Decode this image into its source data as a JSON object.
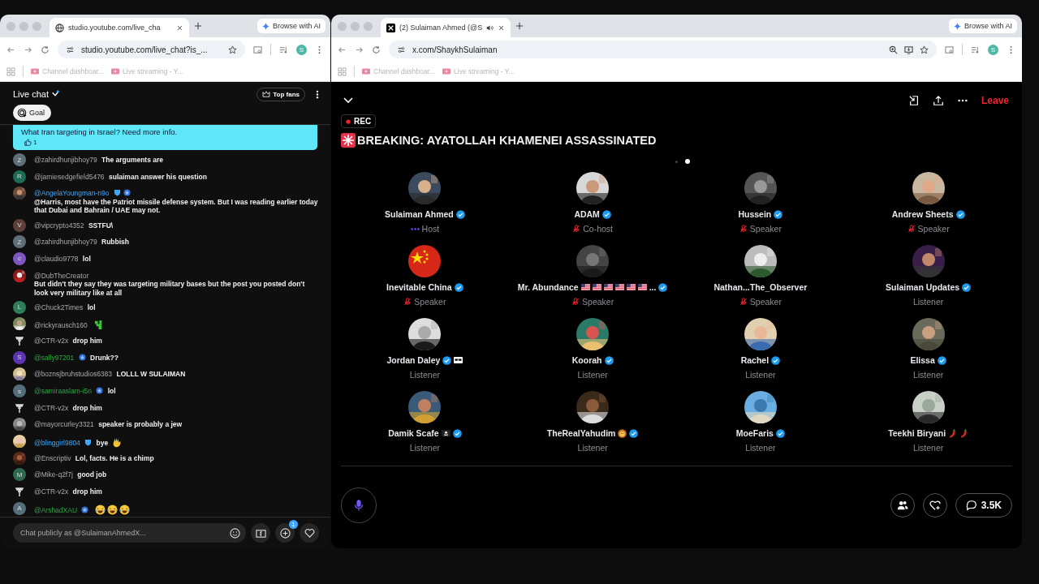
{
  "left_window": {
    "tab": {
      "title": "studio.youtube.com/live_cha"
    },
    "browse_ai": "Browse with AI",
    "url": "studio.youtube.com/live_chat?is_...",
    "profile": "S",
    "bookmarks": [
      "Channel dashboar...",
      "Live streaming - Y..."
    ],
    "chat": {
      "title": "Live chat",
      "top_fans": "Top fans",
      "goal": "Goal",
      "pinned": {
        "text": "What Iran targeting in Israel? Need more info.",
        "likes": "1"
      },
      "messages": [
        {
          "user": "@zahirdhunjibhoy79",
          "kind": "viewer",
          "avatar": {
            "kind": "letter",
            "letter": "Z",
            "color": "#5f6f78"
          },
          "text": "The arguments are"
        },
        {
          "user": "@jamiesedgefield5476",
          "kind": "viewer",
          "avatar": {
            "kind": "letter",
            "letter": "R",
            "color": "#1f6b55"
          },
          "text": "sulaiman answer his question"
        },
        {
          "user": "@AngelaYoungman-n9o",
          "kind": "moderator",
          "avatar": {
            "kind": "picture"
          },
          "badges": [
            {
              "kind": "shield"
            },
            {
              "kind": "star"
            }
          ],
          "text": "@Harris, most have the Patriot missile defense system. But I was reading earlier today that Dubai and Bahrain / UAE may not."
        },
        {
          "user": "@vipcrypto4352",
          "kind": "viewer",
          "avatar": {
            "kind": "letter",
            "letter": "V",
            "color": "#5d4037"
          },
          "text": "SSTFU\\"
        },
        {
          "user": "@zahirdhunjibhoy79",
          "kind": "viewer",
          "avatar": {
            "kind": "letter",
            "letter": "Z",
            "color": "#5f6f78"
          },
          "text": "Rubbish"
        },
        {
          "user": "@claudio9778",
          "kind": "viewer",
          "avatar": {
            "kind": "letter",
            "letter": "c",
            "color": "#7e57c2"
          },
          "text": "lol"
        },
        {
          "user": "@DubTheCreator",
          "kind": "viewer",
          "avatar": {
            "kind": "picture"
          },
          "text": "But didn't they say they was targeting military bases but the post you posted don't look very military like at all"
        },
        {
          "user": "@Chuck2Times",
          "kind": "viewer",
          "avatar": {
            "kind": "letter",
            "letter": "L",
            "color": "#2e7d5b"
          },
          "text": "lol"
        },
        {
          "user": "@rickyrausch160",
          "kind": "viewer",
          "avatar": {
            "kind": "picture"
          },
          "emoji": [
            {
              "kind": "figure"
            }
          ]
        },
        {
          "user": "@CTR-v2x",
          "kind": "viewer",
          "avatar": {
            "kind": "logo"
          },
          "text": "drop him"
        },
        {
          "user": "@sally97201",
          "kind": "member",
          "avatar": {
            "kind": "letter",
            "letter": "S",
            "color": "#5e35b1"
          },
          "badges": [
            {
              "kind": "star"
            }
          ],
          "text": "Drunk??"
        },
        {
          "user": "@boznsjbruhstudios6383",
          "kind": "viewer",
          "avatar": {
            "kind": "picture"
          },
          "text": "LOLLL W SULAIMAN"
        },
        {
          "user": "@samiraaslam-i5n",
          "kind": "member",
          "avatar": {
            "kind": "letter",
            "letter": "s",
            "color": "#546e7a"
          },
          "badges": [
            {
              "kind": "star"
            }
          ],
          "text": "lol"
        },
        {
          "user": "@CTR-v2x",
          "kind": "viewer",
          "avatar": {
            "kind": "logo"
          },
          "text": "drop him"
        },
        {
          "user": "@mayorcurley3321",
          "kind": "viewer",
          "avatar": {
            "kind": "picture"
          },
          "text": "speaker is probably a jew"
        },
        {
          "user": "@blinggirl9804",
          "kind": "moderator",
          "avatar": {
            "kind": "picture"
          },
          "badges": [
            {
              "kind": "shield"
            }
          ],
          "text": "bye",
          "emoji": [
            {
              "kind": "wave"
            }
          ]
        },
        {
          "user": "@Enscriptiv",
          "kind": "viewer",
          "avatar": {
            "kind": "picture"
          },
          "text": "Lol, facts. He is a chimp"
        },
        {
          "user": "@Mike-q2f7j",
          "kind": "viewer",
          "avatar": {
            "kind": "letter",
            "letter": "M",
            "color": "#2e6b4e"
          },
          "text": "good job"
        },
        {
          "user": "@CTR-v2x",
          "kind": "viewer",
          "avatar": {
            "kind": "logo"
          },
          "text": "drop him"
        },
        {
          "user": "@ArshadXAU",
          "kind": "member",
          "avatar": {
            "kind": "letter",
            "letter": "A",
            "color": "#546e7a"
          },
          "badges": [
            {
              "kind": "star"
            }
          ],
          "emoji": [
            {
              "kind": "laugh"
            },
            {
              "kind": "laugh"
            },
            {
              "kind": "laugh"
            }
          ]
        }
      ],
      "input": {
        "placeholder": "Chat publicly as @SulaimanAhmedX..."
      },
      "add_badge": "1"
    }
  },
  "right_window": {
    "tab": {
      "title": "(2) Sulaiman Ahmed (@S"
    },
    "browse_ai": "Browse with AI",
    "url": "x.com/ShaykhSulaiman",
    "profile": "S",
    "bookmarks": [
      "Channel dashboar...",
      "Live streaming - Y..."
    ],
    "space": {
      "leave": "Leave",
      "rec": "REC",
      "title": "BREAKING: AYATOLLAH KHAMENEI ASSASSINATED",
      "pages": [
        {
          "selected": false
        },
        {
          "selected": true
        }
      ],
      "participants": [
        {
          "name": "Sulaiman Ahmed",
          "marks": [
            {
              "kind": "verified"
            }
          ],
          "role": "Host",
          "kind": "host"
        },
        {
          "name": "ADAM",
          "marks": [
            {
              "kind": "verified"
            }
          ],
          "role": "Co-host",
          "kind": "muted"
        },
        {
          "name": "Hussein",
          "marks": [
            {
              "kind": "verified"
            }
          ],
          "role": "Speaker",
          "kind": "muted"
        },
        {
          "name": "Andrew Sheets",
          "marks": [
            {
              "kind": "verified"
            }
          ],
          "role": "Speaker",
          "kind": "muted"
        },
        {
          "name": "Inevitable China",
          "marks": [
            {
              "kind": "verified"
            }
          ],
          "role": "Speaker",
          "kind": "muted"
        },
        {
          "name": "Mr. Abundance",
          "marks": [
            {
              "kind": "flag"
            },
            {
              "kind": "flag"
            },
            {
              "kind": "flag"
            },
            {
              "kind": "flag"
            },
            {
              "kind": "flag"
            },
            {
              "kind": "flag"
            },
            {
              "kind": "text",
              "text": "..."
            },
            {
              "kind": "verified"
            }
          ],
          "role": "Speaker",
          "kind": "muted"
        },
        {
          "name": "Nathan...The_Observer",
          "role": "Speaker",
          "kind": "muted"
        },
        {
          "name": "Sulaiman Updates",
          "marks": [
            {
              "kind": "verified"
            }
          ],
          "role": "Listener",
          "kind": "listener"
        },
        {
          "name": "Jordan Daley",
          "marks": [
            {
              "kind": "verified"
            },
            {
              "kind": "glasses"
            }
          ],
          "role": "Listener",
          "kind": "listener"
        },
        {
          "name": "Koorah",
          "marks": [
            {
              "kind": "verified"
            }
          ],
          "role": "Listener",
          "kind": "listener"
        },
        {
          "name": "Rachel",
          "marks": [
            {
              "kind": "verified"
            }
          ],
          "role": "Listener",
          "kind": "listener"
        },
        {
          "name": "Elissa",
          "marks": [
            {
              "kind": "verified"
            }
          ],
          "role": "Listener",
          "kind": "listener"
        },
        {
          "name": "Damik Scafe",
          "marks": [
            {
              "kind": "pirate-flag"
            },
            {
              "kind": "verified"
            }
          ],
          "role": "Listener",
          "kind": "listener"
        },
        {
          "name": "TheRealYahudim",
          "marks": [
            {
              "kind": "lion"
            },
            {
              "kind": "verified"
            }
          ],
          "role": "Listener",
          "kind": "listener"
        },
        {
          "name": "MoeFaris",
          "marks": [
            {
              "kind": "verified"
            }
          ],
          "role": "Listener",
          "kind": "listener"
        },
        {
          "name": "Teekhi Biryani",
          "marks": [
            {
              "kind": "chili"
            },
            {
              "kind": "chili"
            }
          ],
          "role": "Listener",
          "kind": "listener"
        }
      ],
      "comments": "3.5K"
    }
  }
}
